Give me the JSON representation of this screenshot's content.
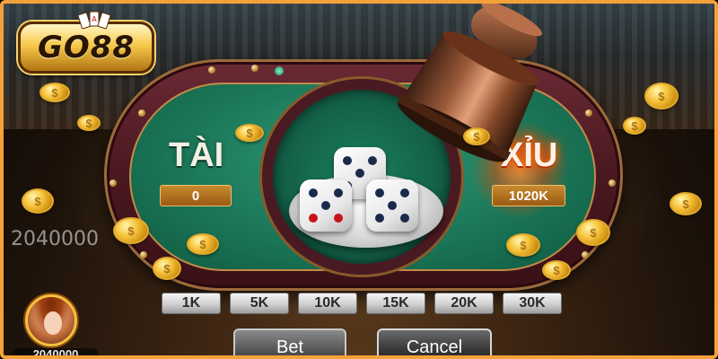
{
  "logo": {
    "text": "GO88"
  },
  "table": {
    "tai": {
      "label": "TÀI",
      "amount": "0"
    },
    "xiu": {
      "label": "XỈU",
      "amount": "1020K"
    }
  },
  "dice": [
    3,
    5,
    4
  ],
  "balance_left": "2040000",
  "balance_bottom": "2040000",
  "chips": [
    "1K",
    "5K",
    "10K",
    "15K",
    "20K",
    "30K"
  ],
  "actions": {
    "bet": "Bet",
    "cancel": "Cancel"
  },
  "colors": {
    "frame": "#f4a13a",
    "felt": "#1d7a5b",
    "rail": "#4a1820",
    "gold": "#f7c33a"
  }
}
